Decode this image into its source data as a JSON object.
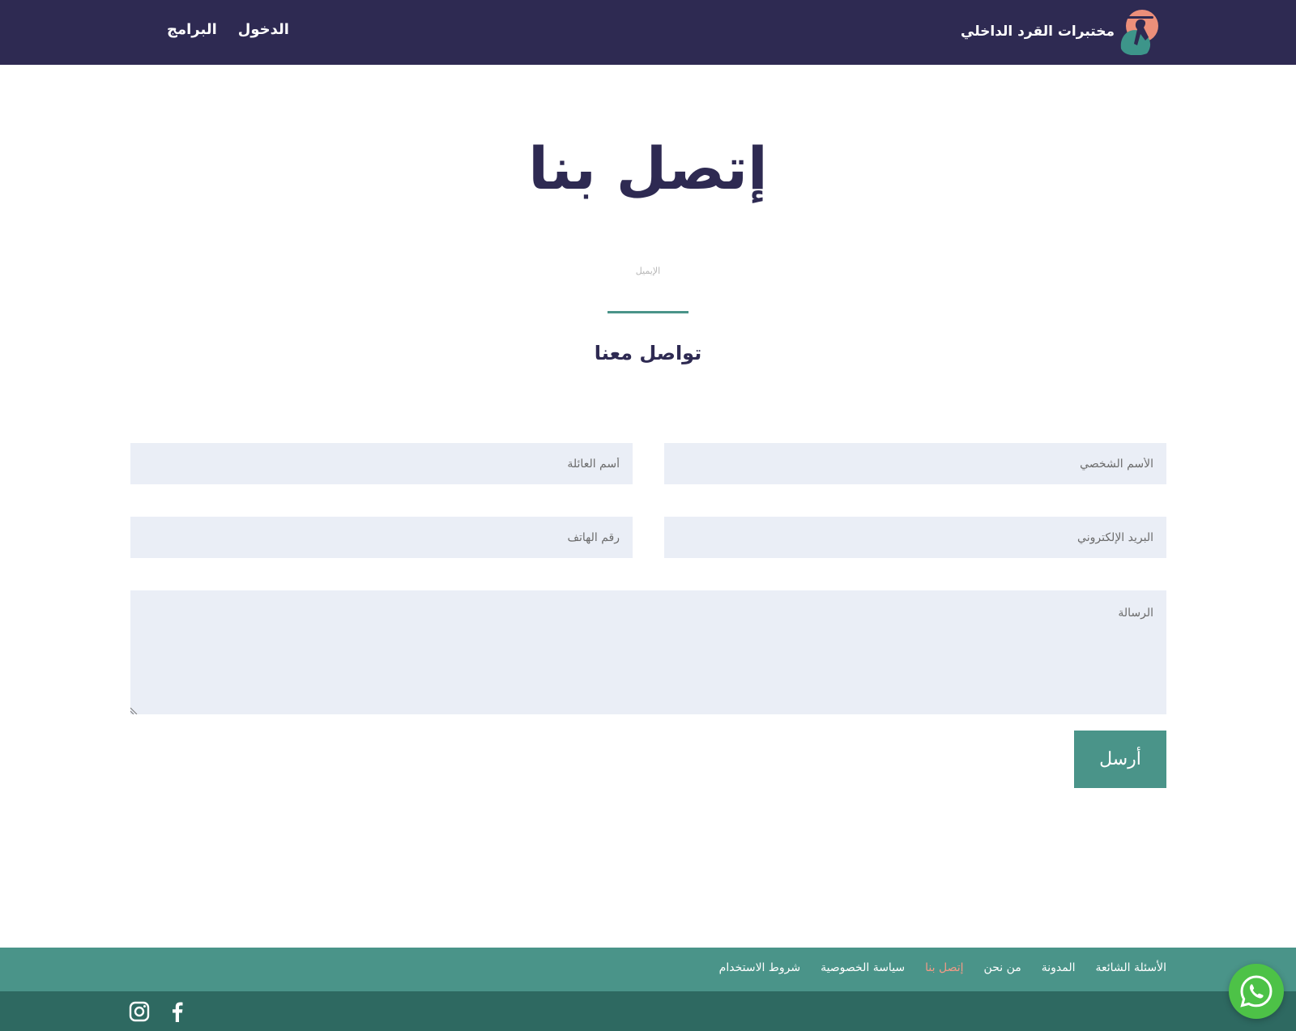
{
  "header": {
    "brand_name": "مختبرات القرد الداخلي",
    "nav": {
      "login": "الدخول",
      "programs": "البرامج"
    }
  },
  "main": {
    "title": "إتصل بنا",
    "email_hint": "الإيميل",
    "subtitle": "تواصل معنا"
  },
  "form": {
    "first_name_placeholder": "الأسم الشخصي",
    "last_name_placeholder": "أسم العائلة",
    "email_placeholder": "البريد الإلكتروني",
    "phone_placeholder": "رقم الهاتف",
    "message_placeholder": "الرسالة",
    "submit_label": "أرسل"
  },
  "footer": {
    "links": {
      "faq": "الأسئلة الشائعة",
      "blog": "المدونة",
      "about": "من نحن",
      "contact": "إتصل بنا",
      "privacy": "سياسة الخصوصية",
      "terms": "شروط الاستخدام"
    },
    "active_link": "contact"
  },
  "icons": {
    "logo": "monkey-logo-icon",
    "instagram": "instagram-icon",
    "facebook": "facebook-icon",
    "whatsapp": "whatsapp-icon"
  },
  "colors": {
    "header_bg": "#2e2a52",
    "accent": "#4a9489",
    "footer_bottom": "#2e6961",
    "active_link": "#f39a86",
    "field_bg": "#eaeef6",
    "whatsapp": "#4dc247"
  }
}
